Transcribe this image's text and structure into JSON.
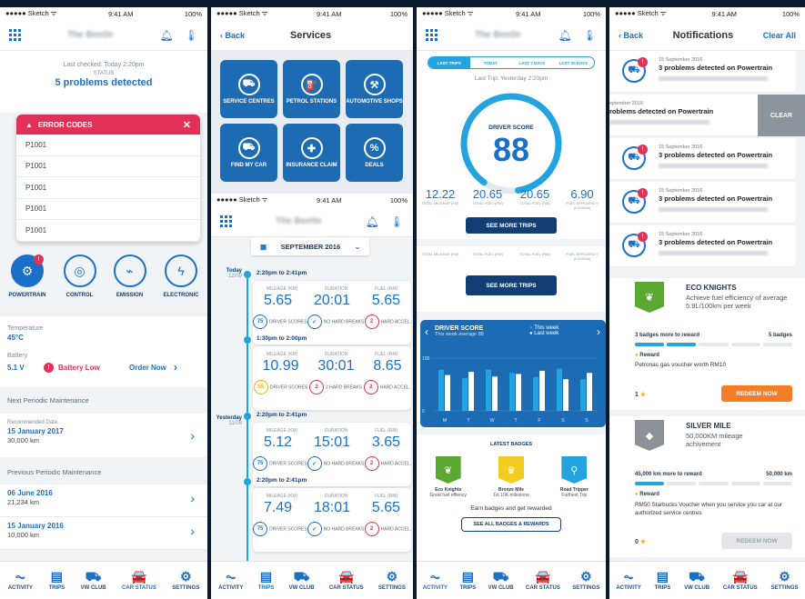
{
  "status_bar": {
    "carrier": "●●●●● Sketch ᯤ",
    "time": "9:41 AM",
    "battery": "100%"
  },
  "p1": {
    "brand": "The Beetle",
    "last_checked": "Last checked: Today 2:20pm",
    "status_label": "STATUS",
    "status_value": "5 problems detected",
    "error_title": "ERROR CODES",
    "codes": [
      "P1001",
      "P1001",
      "P1001",
      "P1001",
      "P1001"
    ],
    "systems": [
      {
        "label": "POWERTRAIN",
        "icon": "engine-icon"
      },
      {
        "label": "CONTROL",
        "icon": "steering-icon"
      },
      {
        "label": "EMISSION",
        "icon": "emission-icon"
      },
      {
        "label": "ELECTRONIC",
        "icon": "electronic-icon"
      }
    ],
    "temp_label": "Temperature",
    "temp_value": "45°C",
    "battery_label": "Battery",
    "battery_value": "5.1 V",
    "battery_warning": "Battery Low",
    "order_now": "Order Now",
    "next_maint": "Next Periodic Maintenance",
    "recommended_label": "Recommended Date",
    "recommended_date": "15 January 2017",
    "recommended_km": "30,000 km",
    "prev_maint": "Previous Periodic Maintenance",
    "prev": [
      {
        "date": "06 June 2016",
        "km": "21,234 km"
      },
      {
        "date": "15 January 2016",
        "km": "10,000 km"
      }
    ]
  },
  "tabs": [
    {
      "label": "ACTIVITY",
      "icon": "activity-icon",
      "glyph": "⏦"
    },
    {
      "label": "TRIPS",
      "icon": "trips-icon",
      "glyph": "▤"
    },
    {
      "label": "VW CLUB",
      "icon": "club-icon",
      "glyph": "⛟"
    },
    {
      "label": "CAR STATUS",
      "icon": "car-icon",
      "glyph": "🚘"
    },
    {
      "label": "SETTINGS",
      "icon": "settings-icon",
      "glyph": "⚙"
    }
  ],
  "p2": {
    "back": "Back",
    "title": "Services",
    "services": [
      "SERVICE CENTRES",
      "PETROL STATIONS",
      "AUTOMOTIVE SHOPS",
      "FIND MY CAR",
      "INSURANCE CLAIM",
      "DEALS"
    ]
  },
  "p3": {
    "brand": "The Beetle",
    "month": "SEPTEMBER 2016",
    "days": [
      {
        "day": "Today",
        "date": "12/09"
      },
      {
        "day": "Yesterday",
        "date": "11/09"
      }
    ],
    "trips": [
      {
        "time": "2:20pm to 2:41pm",
        "mileage": "5.65",
        "duration": "20:01",
        "fuel": "5.65",
        "score": "75",
        "breaks": "NO HARD BREAKS",
        "accel": "2",
        "accel_label": "HARD ACCEL."
      },
      {
        "time": "1:30pm to 2:00pm",
        "mileage": "10.99",
        "duration": "30:01",
        "fuel": "8.65",
        "score": "55",
        "breaks": "2 HARD BREAKS",
        "accel": "2",
        "accel_label": "HARD ACCEL."
      },
      {
        "time": "2:20pm to 2:41pm",
        "mileage": "5.12",
        "duration": "15:01",
        "fuel": "3.65",
        "score": "75",
        "breaks": "NO HARD BREAKS",
        "accel": "2",
        "accel_label": "HARD ACCEL."
      },
      {
        "time": "2:20pm to 2:41pm",
        "mileage": "7.49",
        "duration": "18:01",
        "fuel": "5.65",
        "score": "75",
        "breaks": "NO HARD BREAKS",
        "accel": "2",
        "accel_label": "HARD ACCEL."
      }
    ],
    "col_mileage": "MILEAGE (KM)",
    "col_duration": "DURATION",
    "col_fuel": "FUEL (RM)",
    "driver_scores": "DRIVER SCORES"
  },
  "p4": {
    "brand": "The Beetle",
    "segments": [
      "LAST TRIPS",
      "TODAY",
      "LAST 7 DAYS",
      "LAST 30 DAYS"
    ],
    "last_trip": "Last Trip: Yesterday 2:20pm",
    "score_label": "DRIVER SCORE",
    "score": "88",
    "stats": [
      {
        "v": "12.22",
        "l": "TOTAL MILEAGE (KM)"
      },
      {
        "v": "20.65",
        "l": "TOTAL FUEL (RM)"
      },
      {
        "v": "20.65",
        "l": "TOTAL FUEL (RM)"
      },
      {
        "v": "6.90",
        "l": "FUEL EFFICIENCY (L/100KM)"
      }
    ],
    "see_more": "SEE MORE TRIPS",
    "stats2": [
      "TOTAL MILEAGE (KM)",
      "TOTAL FUEL (RM)",
      "TOTAL FUEL (RM)",
      "FUEL EFFICIENCY (L/100KM)"
    ],
    "chart_title": "DRIVER SCORE",
    "chart_sub": "This week average 88",
    "legend": [
      "This week",
      "Last week"
    ],
    "latest_badges": "LATEST BADGES",
    "badges": [
      {
        "name": "Eco Knights",
        "desc": "Great fuel effiency",
        "color": "#5aa832"
      },
      {
        "name": "Bronze Mile",
        "desc": "1st 10K milestone",
        "color": "#f2cc1f"
      },
      {
        "name": "Road Tripper",
        "desc": "Furthest Trip",
        "color": "#23a3e0"
      }
    ],
    "earn_text": "Earn badges and get rewarded",
    "see_all": "SEE ALL BADGES & REWARDS"
  },
  "chart_data": {
    "type": "bar",
    "categories": [
      "M",
      "T",
      "W",
      "T",
      "F",
      "S",
      "S"
    ],
    "series": [
      {
        "name": "This week",
        "values": [
          78,
          62,
          78,
          72,
          64,
          80,
          60
        ]
      },
      {
        "name": "Last week",
        "values": [
          68,
          74,
          65,
          70,
          76,
          60,
          72
        ]
      }
    ],
    "ylim": [
      0,
      100
    ],
    "yticks": [
      "100",
      "0"
    ]
  },
  "p5": {
    "back": "Back",
    "title": "Notifications",
    "clear_all": "Clear All",
    "notifs": [
      {
        "date": "15 September 2016",
        "text": "3 problems detected on Powertrain"
      },
      {
        "date": "15 September 2016",
        "text": "3 problems detected on Powertrain"
      },
      {
        "date": "15 September 2016",
        "text": "3 problems detected on Powertrain"
      },
      {
        "date": "15 September 2016",
        "text": "3 problems detected on Powertrain"
      }
    ],
    "swiped_date": "eptember 2016",
    "swiped_text": "roblems detected on Powertrain",
    "clear": "CLEAR",
    "eco_title": "ECO KNIGHTS",
    "eco_desc": "Achieve fuel efficiency of average 5.9L/100km per week",
    "eco_more": "3 badges more to reward",
    "eco_total": "5 badges",
    "eco_progress": 0.4,
    "reward_label": "Reward",
    "eco_reward": "Petronas gas voucher worth RM10",
    "eco_count": "1",
    "redeem": "REDEEM NOW",
    "silver_title": "SILVER MILE",
    "silver_desc": "50,000KM mileage achivement",
    "silver_more": "45,000 km more to reward",
    "silver_total": "50,000 km",
    "silver_progress": 0.1,
    "silver_reward": "RM50 Starbucks Voucher when you service you car at our authorized service centres",
    "silver_count": "0"
  }
}
